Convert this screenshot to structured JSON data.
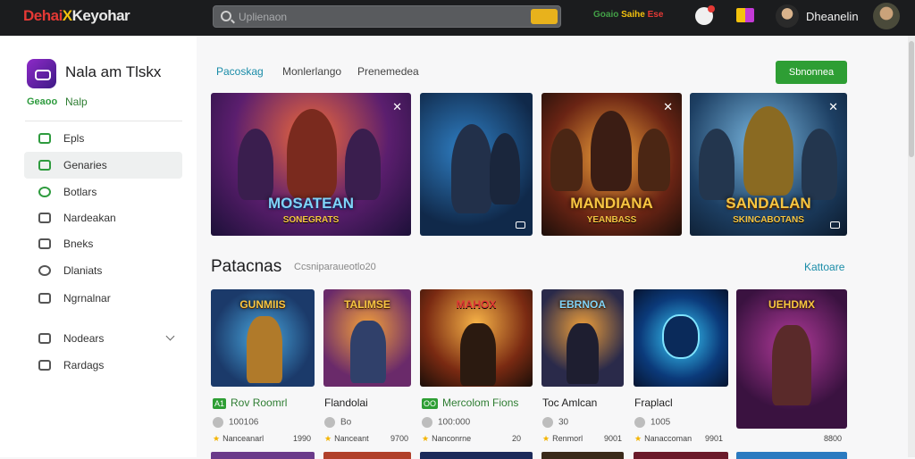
{
  "header": {
    "logo": {
      "part1": "Dehai",
      "part2": "X",
      "part3": "Keyohar"
    },
    "search_placeholder": "Uplienaon",
    "promo": {
      "g": "Goaio",
      "y": "Saihe",
      "r": "Ese"
    },
    "username": "Dheanelin"
  },
  "sidebar": {
    "app_title": "Nala am Tlskx",
    "meta_left": "Geaoo",
    "meta_right": "Nalp",
    "items": [
      {
        "label": "Epls",
        "icon": "chat-icon"
      },
      {
        "label": "Genaries",
        "icon": "chat-icon",
        "active": true
      },
      {
        "label": "Botlars",
        "icon": "leaf-icon"
      },
      {
        "label": "Nardeakan",
        "icon": "monitor-icon"
      },
      {
        "label": "Bneks",
        "icon": "chart-icon"
      },
      {
        "label": "Dlaniats",
        "icon": "compass-icon"
      },
      {
        "label": "Ngrnalnar",
        "icon": "grid-icon"
      },
      {
        "label": "Nodears",
        "icon": "table-icon",
        "expandable": true
      },
      {
        "label": "Rardags",
        "icon": "tag-icon"
      }
    ]
  },
  "main": {
    "tabs": [
      "Pacoskag",
      "Monlerlango",
      "Prenemedea"
    ],
    "primary_button": "Sbnonnea",
    "hero": [
      {
        "title": "MOSATEAN",
        "sub": "SONEGRATS"
      },
      {
        "title": "",
        "sub": ""
      },
      {
        "title": "MANDIANA",
        "sub": "YEANBASS"
      },
      {
        "title": "SANDALAN",
        "sub": "SKINCABOTANS"
      }
    ],
    "section": {
      "title": "Patacnas",
      "subtitle": "Ccsniparaueotlo20",
      "more": "Kattoare"
    },
    "cards": [
      {
        "art": "GUNMIIS",
        "name": "Rov Roomrl",
        "tag": "A1",
        "stat": "100106",
        "foot": "Nanceanarl",
        "price": "1990"
      },
      {
        "art": "TALIMSE",
        "name": "Flandolai",
        "tag": "",
        "stat": "Bo",
        "foot": "Nanceant",
        "price": "9700"
      },
      {
        "art": "MAHOX",
        "name": "Mercolom Fions",
        "tag": "OO",
        "stat": "100:000",
        "foot": "Nanconrne",
        "price": "20"
      },
      {
        "art": "EBRNOA",
        "name": "Toc Amlcan",
        "tag": "",
        "stat": "30",
        "foot": "Renmorl",
        "price": "9001"
      },
      {
        "art": "",
        "name": "Fraplacl",
        "tag": "",
        "stat": "1005",
        "foot": "Nanaccoman",
        "price": "9901"
      },
      {
        "art": "UEHDMX",
        "name": "",
        "tag": "",
        "stat": "",
        "foot": "",
        "price": "8800"
      }
    ],
    "colors": {
      "accent": "#1a8ca8",
      "primary": "#2e9e34",
      "gold": "#f6c542"
    }
  }
}
